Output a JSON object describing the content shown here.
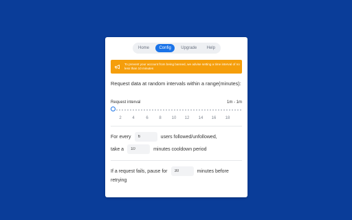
{
  "tabs": [
    {
      "label": "Home",
      "active": false
    },
    {
      "label": "Config",
      "active": true
    },
    {
      "label": "Upgrade",
      "active": false
    },
    {
      "label": "Help",
      "active": false
    }
  ],
  "alert": {
    "icon": "megaphone-icon",
    "text": "To prevent your account from being banned, we advise setting a time interval of no less than 10 minutes",
    "color": "#f59e0b"
  },
  "random_interval": {
    "title": "Request data at random intervals within a range(minutes):",
    "slider_label": "Request interval",
    "slider_value": "1m - 1m",
    "ticks": [
      "2",
      "4",
      "6",
      "8",
      "10",
      "12",
      "14",
      "16",
      "18"
    ]
  },
  "cooldown": {
    "prefix": "For every",
    "users_value": "6",
    "users_suffix": "users followed/unfollowed,",
    "take_prefix": "take a",
    "minutes_value": "10",
    "minutes_suffix": "minutes cooldown period"
  },
  "failure": {
    "prefix": "If a request fails, pause for",
    "minutes_value": "30",
    "suffix": "minutes before",
    "suffix2": "retrying"
  },
  "colors": {
    "background": "#0a3d99",
    "accent": "#1a73e8"
  }
}
